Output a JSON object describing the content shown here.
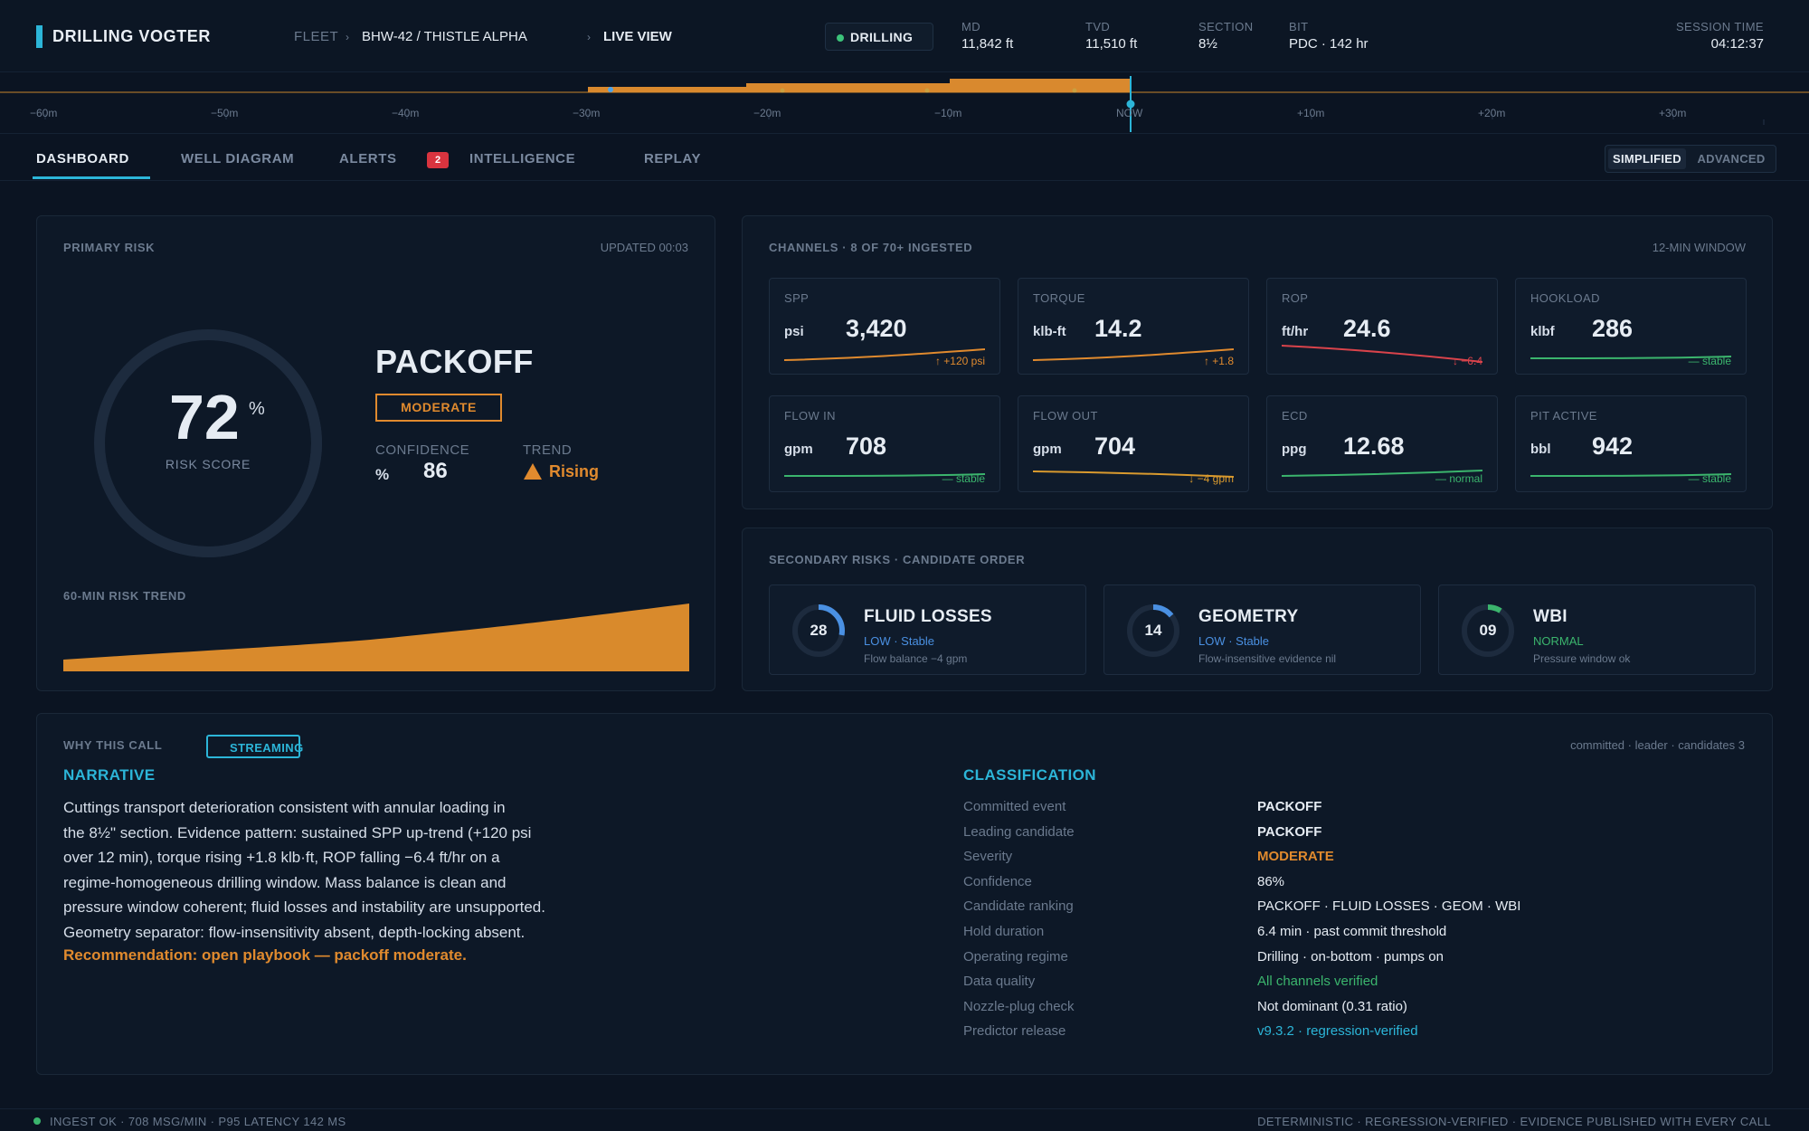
{
  "header": {
    "brand": "DRILLING VOGTER",
    "fleet_label": "FLEET",
    "sep": "›",
    "well": "BHW-42 / THISTLE ALPHA",
    "view": "LIVE VIEW",
    "status": "DRILLING",
    "stats": [
      {
        "label": "MD",
        "value": "11,842 ft"
      },
      {
        "label": "TVD",
        "value": "11,510 ft"
      },
      {
        "label": "SECTION",
        "value": "8½"
      },
      {
        "label": "BIT",
        "value": "PDC · 142 hr"
      }
    ],
    "session_label": "SESSION TIME",
    "session_value": "04:12:37"
  },
  "timeline": {
    "ticks": [
      "−60m",
      "−50m",
      "−40m",
      "−30m",
      "−20m",
      "−10m",
      "NOW",
      "+10m",
      "+20m",
      "+30m"
    ]
  },
  "tabs": [
    {
      "label": "DASHBOARD"
    },
    {
      "label": "WELL DIAGRAM"
    },
    {
      "label": "ALERTS"
    },
    {
      "label": "INTELLIGENCE"
    },
    {
      "label": "REPLAY"
    }
  ],
  "alerts_badge": "2",
  "mode_toggle": {
    "simplified": "SIMPLIFIED",
    "advanced": "ADVANCED"
  },
  "primary": {
    "title": "PRIMARY RISK",
    "updated": "UPDATED 00:03",
    "score": "72",
    "score_unit": "%",
    "score_label": "RISK SCORE",
    "score_fraction": 0.72,
    "event": "PACKOFF",
    "severity": "MODERATE",
    "confidence_label": "CONFIDENCE",
    "confidence_unit": "%",
    "confidence_value": "86",
    "trend_label": "TREND",
    "trend_value": "Rising",
    "trend_title": "60-MIN RISK TREND"
  },
  "channels": {
    "title": "CHANNELS · 8 OF 70+ INGESTED",
    "window": "12-MIN WINDOW",
    "items": [
      {
        "name": "SPP",
        "unit": "psi",
        "value": "3,420",
        "note": "↑ +120 psi",
        "color": "#e08a2e"
      },
      {
        "name": "TORQUE",
        "unit": "klb-ft",
        "value": "14.2",
        "note": "↑ +1.8",
        "color": "#e08a2e"
      },
      {
        "name": "ROP",
        "unit": "ft/hr",
        "value": "24.6",
        "note": "↓ −6.4",
        "color": "#d9434b"
      },
      {
        "name": "HOOKLOAD",
        "unit": "klbf",
        "value": "286",
        "note": "— stable",
        "color": "#3bb56d"
      },
      {
        "name": "FLOW IN",
        "unit": "gpm",
        "value": "708",
        "note": "— stable",
        "color": "#3bb56d"
      },
      {
        "name": "FLOW OUT",
        "unit": "gpm",
        "value": "704",
        "note": "↓ −4 gpm",
        "color": "#d99a2e"
      },
      {
        "name": "ECD",
        "unit": "ppg",
        "value": "12.68",
        "note": "— normal",
        "color": "#3bb56d"
      },
      {
        "name": "PIT ACTIVE",
        "unit": "bbl",
        "value": "942",
        "note": "— stable",
        "color": "#3bb56d"
      }
    ]
  },
  "secondary": {
    "title": "SECONDARY RISKS · CANDIDATE ORDER",
    "items": [
      {
        "score": "28",
        "fraction": 0.28,
        "name": "FLUID LOSSES",
        "sub": "LOW · Stable",
        "note": "Flow balance −4 gpm",
        "color": "#4a90e2"
      },
      {
        "score": "14",
        "fraction": 0.14,
        "name": "GEOMETRY",
        "sub": "LOW · Stable",
        "note": "Flow-insensitive evidence nil",
        "color": "#4a90e2"
      },
      {
        "score": "09",
        "fraction": 0.09,
        "name": "WBI",
        "sub": "NORMAL",
        "note": "Pressure window ok",
        "color": "#3bb56d"
      }
    ]
  },
  "why": {
    "title": "WHY THIS CALL",
    "streaming": "STREAMING",
    "meta": "committed · leader · candidates 3",
    "narrative_title": "NARRATIVE",
    "narrative_lines": [
      "Cuttings transport deterioration consistent with annular loading in",
      "the 8½\" section. Evidence pattern: sustained SPP up-trend (+120 psi",
      "over 12 min), torque rising +1.8 klb·ft, ROP falling −6.4 ft/hr on a",
      "regime-homogeneous drilling window. Mass balance is clean and",
      "pressure window coherent; fluid losses and instability are unsupported.",
      "Geometry separator: flow-insensitivity absent, depth-locking absent."
    ],
    "recommendation": "Recommendation: open playbook — packoff moderate.",
    "classification_title": "CLASSIFICATION",
    "classification": [
      {
        "label": "Committed event",
        "value": "PACKOFF",
        "color": "#e6ecf3"
      },
      {
        "label": "Leading candidate",
        "value": "PACKOFF",
        "color": "#e6ecf3"
      },
      {
        "label": "Severity",
        "value": "MODERATE",
        "color": "#e08a2e"
      },
      {
        "label": "Confidence",
        "value": "86%",
        "color": "#e6ecf3"
      },
      {
        "label": "Candidate ranking",
        "value": "PACKOFF · FLUID LOSSES · GEOM · WBI",
        "color": "#e6ecf3"
      },
      {
        "label": "Hold duration",
        "value": "6.4 min · past commit threshold",
        "color": "#e6ecf3"
      },
      {
        "label": "Operating regime",
        "value": "Drilling · on-bottom · pumps on",
        "color": "#e6ecf3"
      },
      {
        "label": "Data quality",
        "value": "All channels verified",
        "color": "#3bb56d"
      },
      {
        "label": "Nozzle-plug check",
        "value": "Not dominant (0.31 ratio)",
        "color": "#e6ecf3"
      },
      {
        "label": "Predictor release",
        "value": "v9.3.2 · regression-verified",
        "color": "#2cb5d8"
      }
    ]
  },
  "footer": {
    "left": "INGEST OK · 708 MSG/MIN · P95 LATENCY 142 MS",
    "right": "DETERMINISTIC · REGRESSION-VERIFIED · EVIDENCE PUBLISHED WITH EVERY CALL"
  },
  "colors": {
    "accent": "#2cb5d8",
    "risk": "#e08a2e",
    "ok": "#3bb56d",
    "low": "#4a90e2"
  }
}
